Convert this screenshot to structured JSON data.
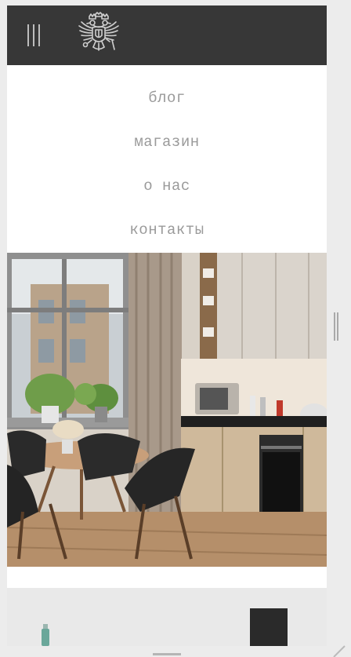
{
  "nav": {
    "items": [
      {
        "label": "блог"
      },
      {
        "label": "магазин"
      },
      {
        "label": "о нас"
      },
      {
        "label": "контакты"
      }
    ]
  },
  "icons": {
    "menu": "hamburger-icon",
    "logo": "double-headed-eagle-emblem"
  },
  "colors": {
    "header": "#373737",
    "nav_text": "#9a9a9a",
    "page_background": "#ececec"
  }
}
